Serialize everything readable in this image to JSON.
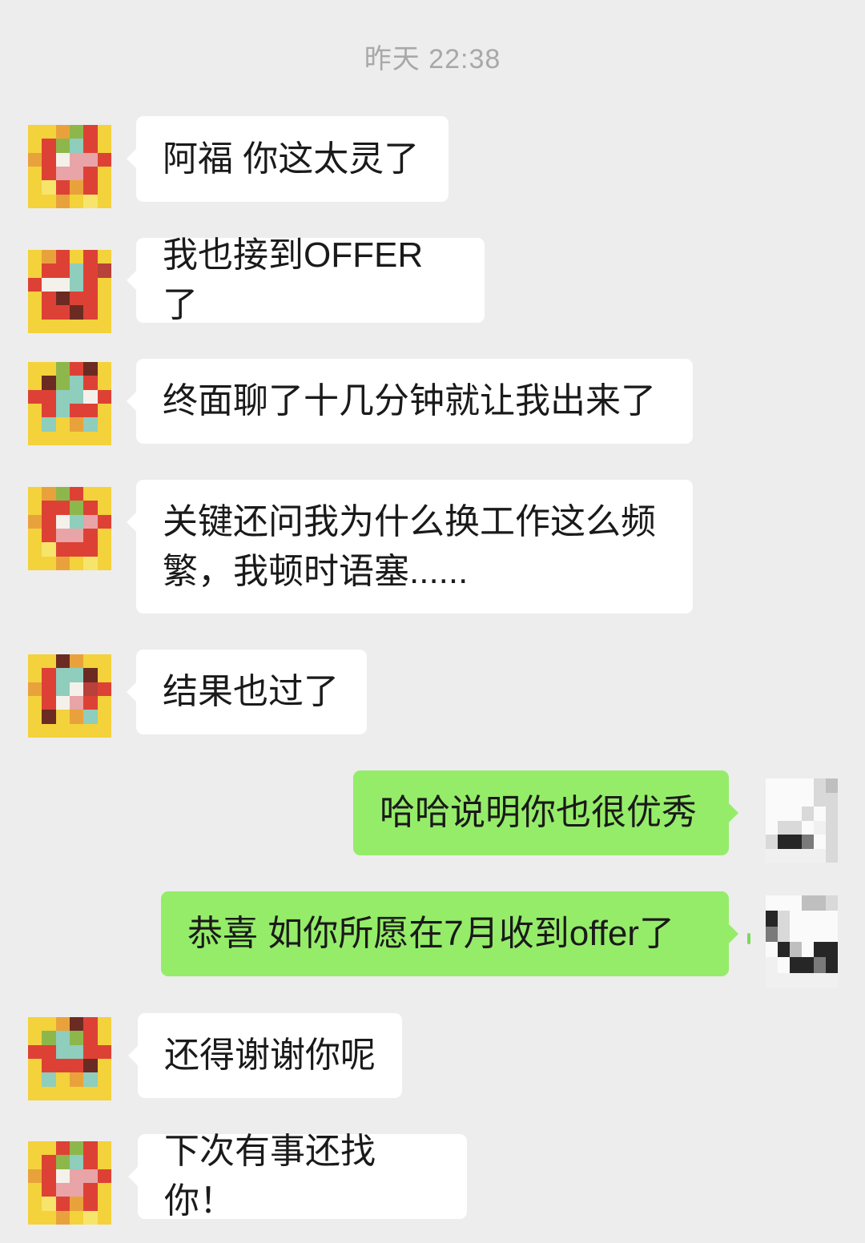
{
  "timestamp": "昨天 22:38",
  "colors": {
    "chat_background": "#ededed",
    "incoming_bubble": "#ffffff",
    "outgoing_bubble": "#95ec69",
    "timestamp_text": "#a8a8a8",
    "message_text": "#1a1a1a"
  },
  "messages": [
    {
      "direction": "incoming",
      "text": "阿福 你这太灵了"
    },
    {
      "direction": "incoming",
      "text": "我也接到OFFER了"
    },
    {
      "direction": "incoming",
      "text": "终面聊了十几分钟就让我出来了"
    },
    {
      "direction": "incoming",
      "text": "关键还问我为什么换工作这么频繁，我顿时语塞......"
    },
    {
      "direction": "incoming",
      "text": "结果也过了"
    },
    {
      "direction": "outgoing",
      "text": "哈哈说明你也很优秀"
    },
    {
      "direction": "outgoing",
      "text": "恭喜 如你所愿在7月收到offer了"
    },
    {
      "direction": "incoming",
      "text": "还得谢谢你呢"
    },
    {
      "direction": "incoming",
      "text": "下次有事还找你！"
    }
  ]
}
